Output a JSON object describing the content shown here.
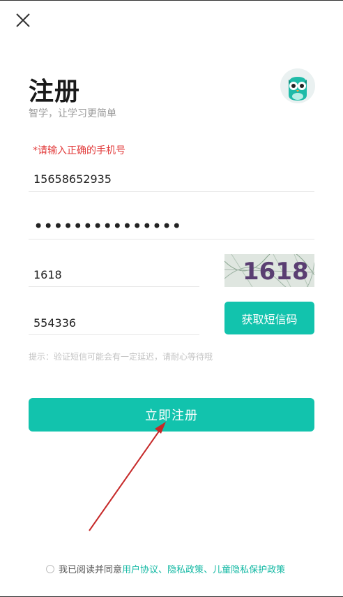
{
  "header": {
    "close_icon": "close-icon"
  },
  "page": {
    "title": "注册",
    "subtitle": "智学，让学习更简单",
    "logo_icon": "owl-logo"
  },
  "form": {
    "error_text": "*请输入正确的手机号",
    "phone_value": "15658652935",
    "password_masked": "•••••••••••••••",
    "captcha_value": "1618",
    "captcha_image_text": "1618",
    "sms_code_value": "554336",
    "sms_button_label": "获取短信码",
    "hint": "提示：验证短信可能会有一定延迟，请耐心等待哦"
  },
  "actions": {
    "register_label": "立即注册"
  },
  "agreement": {
    "prefix": "我已阅读并同意",
    "user_agreement": "用户协议",
    "sep1": "、",
    "privacy_policy": "隐私政策",
    "sep2": "、",
    "child_privacy_policy": "儿童隐私保护政策",
    "checked": false
  },
  "colors": {
    "accent": "#12c3ad",
    "error": "#e23b3b",
    "annotation_arrow": "#c62828"
  }
}
